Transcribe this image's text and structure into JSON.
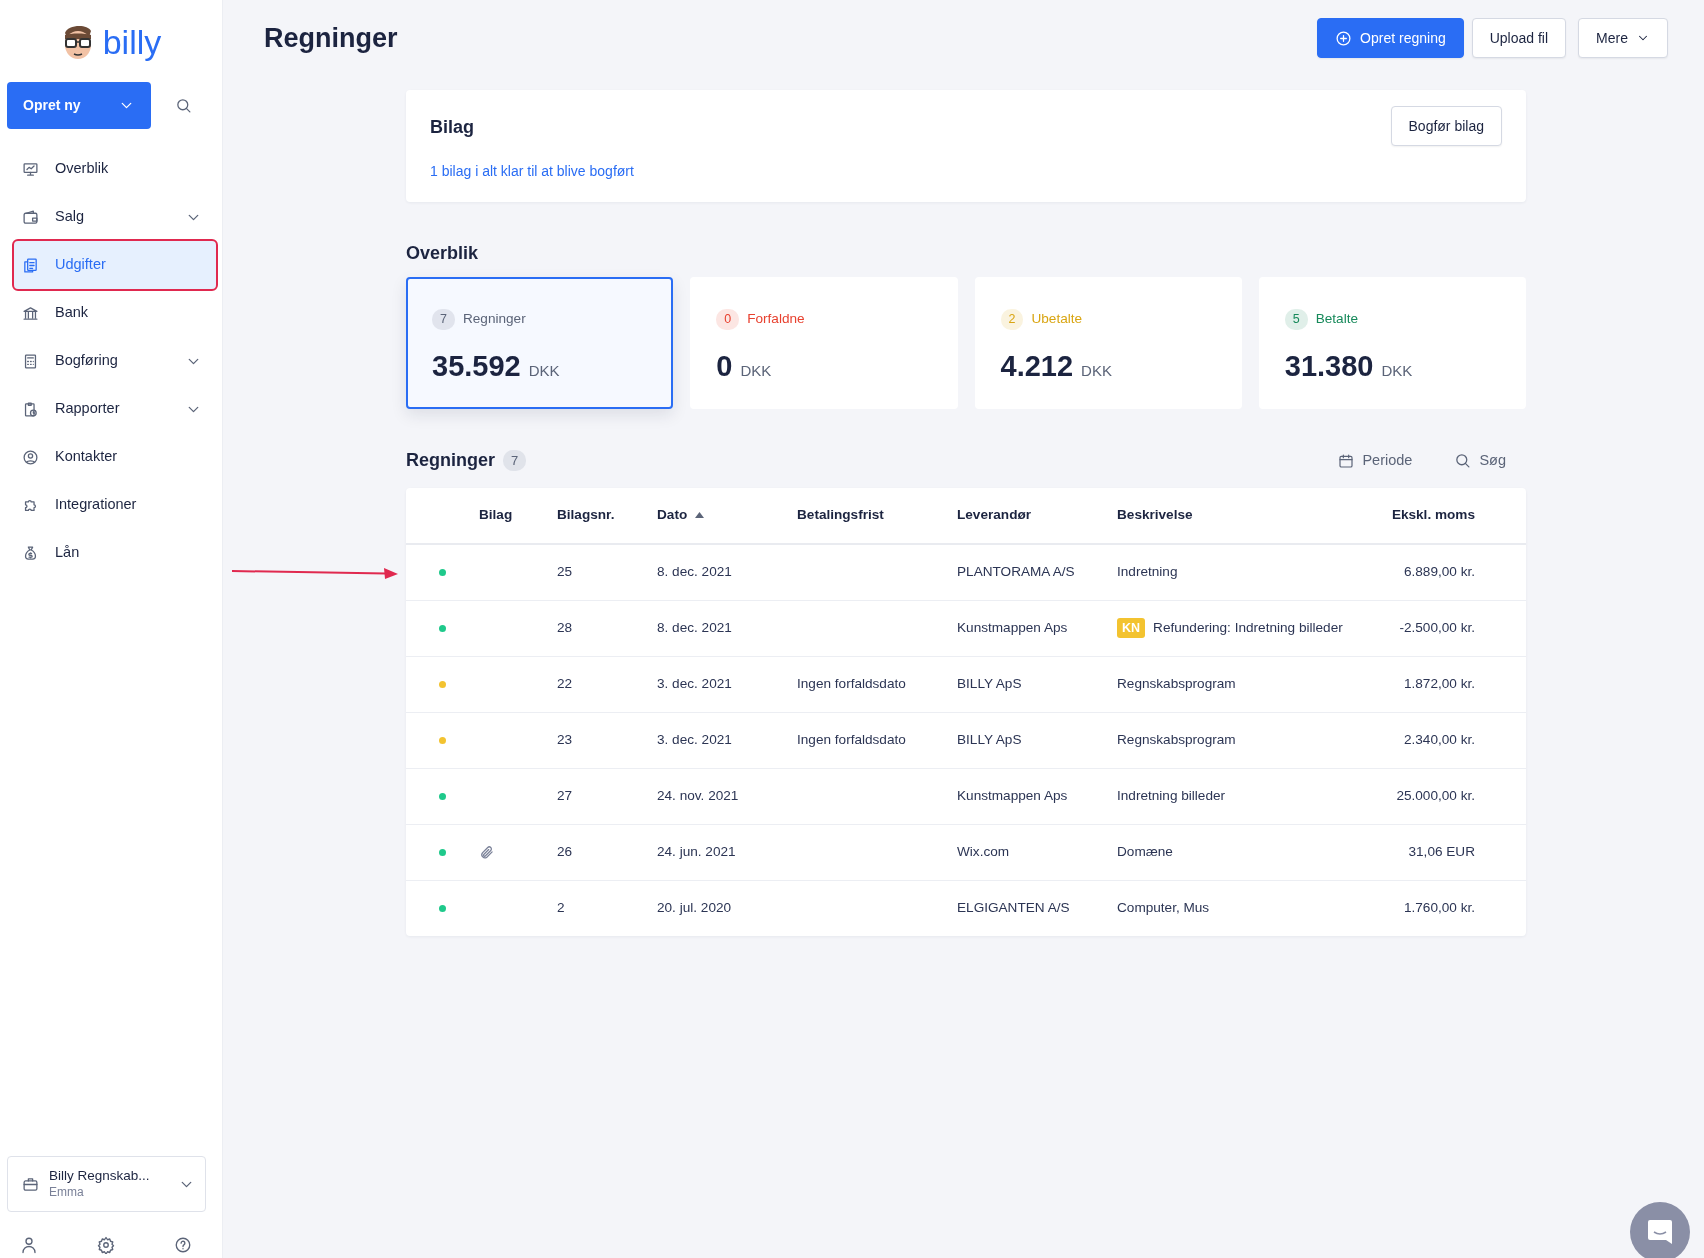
{
  "sidebar": {
    "logo": "billy",
    "create_button": "Opret ny",
    "items": [
      {
        "label": "Overblik",
        "selected": false,
        "expandable": false,
        "highlighted": false
      },
      {
        "label": "Salg",
        "selected": false,
        "expandable": true,
        "highlighted": false
      },
      {
        "label": "Udgifter",
        "selected": true,
        "expandable": false,
        "highlighted": true
      },
      {
        "label": "Bank",
        "selected": false,
        "expandable": false,
        "highlighted": false
      },
      {
        "label": "Bogføring",
        "selected": false,
        "expandable": true,
        "highlighted": false
      },
      {
        "label": "Rapporter",
        "selected": false,
        "expandable": true,
        "highlighted": false
      },
      {
        "label": "Kontakter",
        "selected": false,
        "expandable": false,
        "highlighted": false
      },
      {
        "label": "Integrationer",
        "selected": false,
        "expandable": false,
        "highlighted": false
      },
      {
        "label": "Lån",
        "selected": false,
        "expandable": false,
        "highlighted": false
      }
    ],
    "organization": {
      "name": "Billy Regnskab...",
      "user": "Emma"
    }
  },
  "page": {
    "title": "Regninger",
    "buttons": [
      {
        "label": "Opret regning",
        "kind": "primary"
      },
      {
        "label": "Upload fil",
        "kind": "default"
      },
      {
        "label": "Mere",
        "kind": "dropdown"
      }
    ]
  },
  "bilag_card": {
    "title": "Bilag",
    "link": "1 bilag i alt klar til at blive bogført",
    "button": "Bogfør bilag"
  },
  "overview": {
    "title": "Overblik",
    "cards": [
      {
        "count": "7",
        "label": "Regninger",
        "amount": "35.592",
        "currency": "DKK",
        "color": "#5b6478",
        "selected": true
      },
      {
        "count": "0",
        "label": "Forfaldne",
        "amount": "0",
        "currency": "DKK",
        "color": "#e8412f",
        "selected": false
      },
      {
        "count": "2",
        "label": "Ubetalte",
        "amount": "4.212",
        "currency": "DKK",
        "color": "#d9a512",
        "selected": false
      },
      {
        "count": "5",
        "label": "Betalte",
        "amount": "31.380",
        "currency": "DKK",
        "color": "#16895a",
        "selected": false
      }
    ]
  },
  "table": {
    "annotation_arrow": true,
    "title": "Regninger",
    "count": "7",
    "period_button": "Periode",
    "search_button": "Søg",
    "columns": [
      {
        "label": "Bilag",
        "sorted": false
      },
      {
        "label": "Bilagsnr.",
        "sorted": false
      },
      {
        "label": "Dato",
        "sorted": true
      },
      {
        "label": "Betalingsfrist",
        "sorted": false
      },
      {
        "label": "Leverandør",
        "sorted": false
      },
      {
        "label": "Beskrivelse",
        "sorted": false
      },
      {
        "label": "Ekskl. moms",
        "sorted": false
      }
    ],
    "rows": [
      {
        "color": "#1fc98b",
        "attachment": false,
        "number": "25",
        "date": "8. dec. 2021",
        "supplier": "PLANTORAMA A/S",
        "description": "Indretning",
        "amount": "6.889,00 kr."
      },
      {
        "color": "#1fc98b",
        "attachment": false,
        "number": "28",
        "date": "8. dec. 2021",
        "supplier": "Kunstmappen Aps",
        "tag": "KN",
        "description": "Refundering: Indretning billeder",
        "amount": "-2.500,00 kr."
      },
      {
        "color": "#f3c330",
        "attachment": false,
        "number": "22",
        "date": "3. dec. 2021",
        "due": "Ingen forfaldsdato",
        "supplier": "BILLY ApS",
        "description": "Regnskabsprogram",
        "amount": "1.872,00 kr."
      },
      {
        "color": "#f3c330",
        "attachment": false,
        "number": "23",
        "date": "3. dec. 2021",
        "due": "Ingen forfaldsdato",
        "supplier": "BILLY ApS",
        "description": "Regnskabsprogram",
        "amount": "2.340,00 kr."
      },
      {
        "color": "#1fc98b",
        "attachment": false,
        "number": "27",
        "date": "24. nov. 2021",
        "supplier": "Kunstmappen Aps",
        "description": "Indretning billeder",
        "amount": "25.000,00 kr."
      },
      {
        "color": "#1fc98b",
        "attachment": true,
        "number": "26",
        "date": "24. jun. 2021",
        "supplier": "Wix.com",
        "description": "Domæne",
        "amount": "31,06 EUR"
      },
      {
        "color": "#1fc98b",
        "attachment": false,
        "number": "2",
        "date": "20. jul. 2020",
        "supplier": "ELGIGANTEN A/S",
        "description": "Computer, Mus",
        "amount": "1.760,00 kr."
      }
    ]
  }
}
